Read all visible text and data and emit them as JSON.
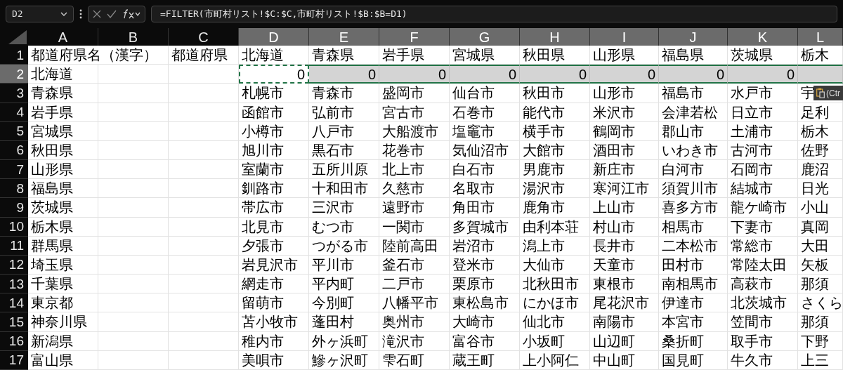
{
  "name_box": {
    "value": "D2"
  },
  "formula_bar": {
    "formula": "=FILTER(市町村リスト!$C:$C,市町村リスト!$B:$B=D1)"
  },
  "columns": [
    {
      "label": "A",
      "selected": false
    },
    {
      "label": "B",
      "selected": false
    },
    {
      "label": "C",
      "selected": false
    },
    {
      "label": "D",
      "selected": true
    },
    {
      "label": "E",
      "selected": true
    },
    {
      "label": "F",
      "selected": true
    },
    {
      "label": "G",
      "selected": true
    },
    {
      "label": "H",
      "selected": true
    },
    {
      "label": "I",
      "selected": true
    },
    {
      "label": "J",
      "selected": true
    },
    {
      "label": "K",
      "selected": true
    },
    {
      "label": "L",
      "selected": true
    }
  ],
  "rows": [
    {
      "label": "1",
      "selected": false,
      "cells": [
        "都道府県名（漢字）",
        null,
        "都道府県",
        "北海道",
        "青森県",
        "岩手県",
        "宮城県",
        "秋田県",
        "山形県",
        "福島県",
        "茨城県",
        "栃木"
      ]
    },
    {
      "label": "2",
      "selected": true,
      "cells": [
        "北海道",
        null,
        null,
        "0",
        "0",
        "0",
        "0",
        "0",
        "0",
        "0",
        "0",
        null
      ]
    },
    {
      "label": "3",
      "selected": false,
      "cells": [
        "青森県",
        null,
        null,
        "札幌市",
        "青森市",
        "盛岡市",
        "仙台市",
        "秋田市",
        "山形市",
        "福島市",
        "水戸市",
        "宇"
      ]
    },
    {
      "label": "4",
      "selected": false,
      "cells": [
        "岩手県",
        null,
        null,
        "函館市",
        "弘前市",
        "宮古市",
        "石巻市",
        "能代市",
        "米沢市",
        "会津若松",
        "日立市",
        "足利"
      ]
    },
    {
      "label": "5",
      "selected": false,
      "cells": [
        "宮城県",
        null,
        null,
        "小樽市",
        "八戸市",
        "大船渡市",
        "塩竈市",
        "横手市",
        "鶴岡市",
        "郡山市",
        "土浦市",
        "栃木"
      ]
    },
    {
      "label": "6",
      "selected": false,
      "cells": [
        "秋田県",
        null,
        null,
        "旭川市",
        "黒石市",
        "花巻市",
        "気仙沼市",
        "大館市",
        "酒田市",
        "いわき市",
        "古河市",
        "佐野"
      ]
    },
    {
      "label": "7",
      "selected": false,
      "cells": [
        "山形県",
        null,
        null,
        "室蘭市",
        "五所川原",
        "北上市",
        "白石市",
        "男鹿市",
        "新庄市",
        "白河市",
        "石岡市",
        "鹿沼"
      ]
    },
    {
      "label": "8",
      "selected": false,
      "cells": [
        "福島県",
        null,
        null,
        "釧路市",
        "十和田市",
        "久慈市",
        "名取市",
        "湯沢市",
        "寒河江市",
        "須賀川市",
        "結城市",
        "日光"
      ]
    },
    {
      "label": "9",
      "selected": false,
      "cells": [
        "茨城県",
        null,
        null,
        "帯広市",
        "三沢市",
        "遠野市",
        "角田市",
        "鹿角市",
        "上山市",
        "喜多方市",
        "龍ケ崎市",
        "小山"
      ]
    },
    {
      "label": "10",
      "selected": false,
      "cells": [
        "栃木県",
        null,
        null,
        "北見市",
        "むつ市",
        "一関市",
        "多賀城市",
        "由利本荘",
        "村山市",
        "相馬市",
        "下妻市",
        "真岡"
      ]
    },
    {
      "label": "11",
      "selected": false,
      "cells": [
        "群馬県",
        null,
        null,
        "夕張市",
        "つがる市",
        "陸前高田",
        "岩沼市",
        "潟上市",
        "長井市",
        "二本松市",
        "常総市",
        "大田"
      ]
    },
    {
      "label": "12",
      "selected": false,
      "cells": [
        "埼玉県",
        null,
        null,
        "岩見沢市",
        "平川市",
        "釜石市",
        "登米市",
        "大仙市",
        "天童市",
        "田村市",
        "常陸太田",
        "矢板"
      ]
    },
    {
      "label": "13",
      "selected": false,
      "cells": [
        "千葉県",
        null,
        null,
        "網走市",
        "平内町",
        "二戸市",
        "栗原市",
        "北秋田市",
        "東根市",
        "南相馬市",
        "高萩市",
        "那須"
      ]
    },
    {
      "label": "14",
      "selected": false,
      "cells": [
        "東京都",
        null,
        null,
        "留萌市",
        "今別町",
        "八幡平市",
        "東松島市",
        "にかほ市",
        "尾花沢市",
        "伊達市",
        "北茨城市",
        "さくら"
      ]
    },
    {
      "label": "15",
      "selected": false,
      "cells": [
        "神奈川県",
        null,
        null,
        "苫小牧市",
        "蓬田村",
        "奥州市",
        "大崎市",
        "仙北市",
        "南陽市",
        "本宮市",
        "笠間市",
        "那須"
      ]
    },
    {
      "label": "16",
      "selected": false,
      "cells": [
        "新潟県",
        null,
        null,
        "稚内市",
        "外ヶ浜町",
        "滝沢市",
        "富谷市",
        "小坂町",
        "山辺町",
        "桑折町",
        "取手市",
        "下野"
      ]
    },
    {
      "label": "17",
      "selected": false,
      "cells": [
        "富山県",
        null,
        null,
        "美唄市",
        "鰺ヶ沢町",
        "雫石町",
        "蔵王町",
        "上小阿仁",
        "中山町",
        "国見町",
        "牛久市",
        "上三"
      ]
    }
  ],
  "paste_options": {
    "label": "(Ctr"
  }
}
